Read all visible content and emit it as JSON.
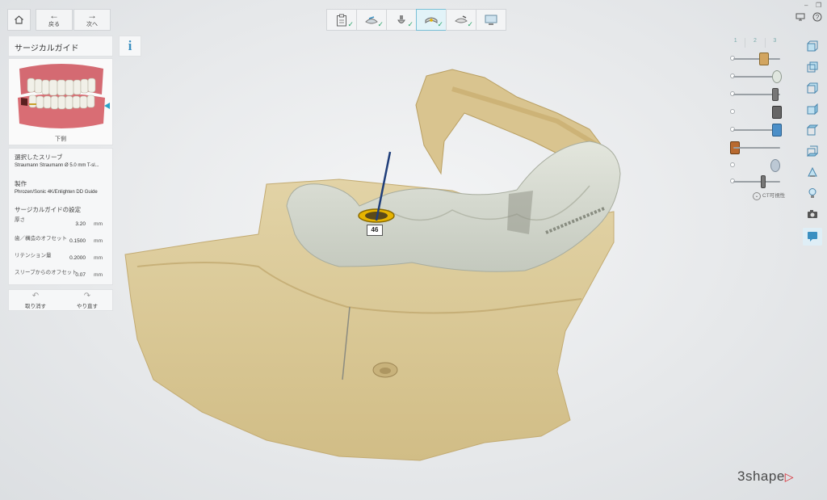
{
  "nav": {
    "back_label": "戻る",
    "next_label": "次へ"
  },
  "workflow_steps": [
    {
      "icon": "clipboard-icon",
      "done": true
    },
    {
      "icon": "scan-import-icon",
      "done": true
    },
    {
      "icon": "implant-plan-icon",
      "done": true
    },
    {
      "icon": "surgical-guide-icon",
      "done": true,
      "active": true
    },
    {
      "icon": "guide-finish-icon",
      "done": true
    },
    {
      "icon": "export-icon",
      "done": false
    }
  ],
  "panel": {
    "title": "サージカルガイド",
    "preview_label": "下側",
    "sleeve_heading": "選択したスリーブ",
    "sleeve_value": "Straumann Straumann Ø 5.0 mm T-sl...",
    "manufacturing_heading": "製作",
    "manufacturing_value": "Phrozen/Sonic 4K/Enlighten DD Guide",
    "settings_heading": "サージカルガイドの設定",
    "settings": [
      {
        "label": "厚さ",
        "value": "3.20",
        "unit": "mm"
      },
      {
        "label": "歯／構造のオフセット",
        "value": "0.1500",
        "unit": "mm"
      },
      {
        "label": "リテンション量",
        "value": "0.2000",
        "unit": "mm"
      },
      {
        "label": "スリーブからのオフセット",
        "value": "0.07",
        "unit": "mm"
      }
    ],
    "undo_label": "取り消す",
    "redo_label": "やり直す"
  },
  "viewport": {
    "tooth_number": "46"
  },
  "right_panel": {
    "tabs": [
      "1",
      "2",
      "3"
    ],
    "ct_label": "CT可視性"
  },
  "brand": {
    "logo": "3shape"
  },
  "colors": {
    "accent": "#3a8fc1",
    "check": "#2aa66a",
    "guide": "#d9dcd3",
    "bone": "#d6c38f",
    "sleeve": "#e7b400",
    "logo_triangle": "#d8232a"
  }
}
